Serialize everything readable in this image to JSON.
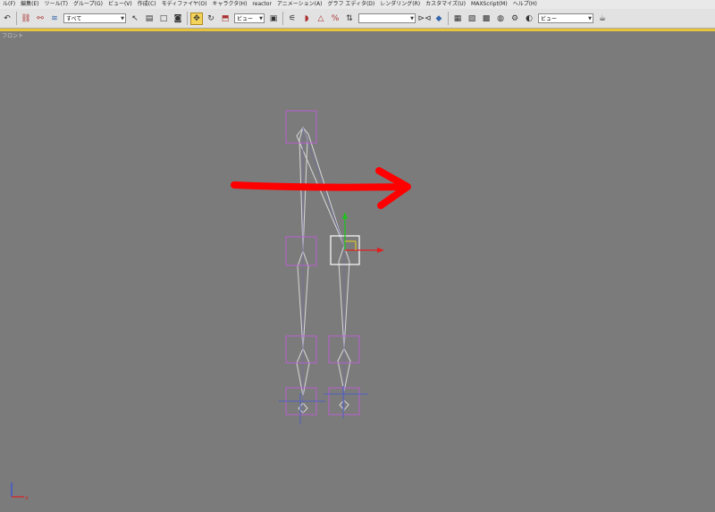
{
  "menu": [
    "ル(F)",
    "編集(E)",
    "ツール(T)",
    "グループ(G)",
    "ビュー(V)",
    "作成(C)",
    "モディファイヤ(O)",
    "キャラクタ(H)",
    "reactor",
    "アニメーション(A)",
    "グラフ エディタ(D)",
    "レンダリング(R)",
    "カスタマイズ(U)",
    "MAXScript(M)",
    "ヘルプ(H)"
  ],
  "toolbar": {
    "selection_filter": "すべて",
    "coord_system": "ビュー",
    "named_selection": "",
    "render_preset": "ビュー",
    "icons": [
      "undo-icon",
      "redo-icon",
      "link-icon",
      "unlink-icon",
      "bind-space-warp-icon",
      "select-icon",
      "select-by-name-icon",
      "rect-region-icon",
      "window-crossing-icon",
      "move-icon",
      "rotate-icon",
      "scale-icon",
      "pivot-icon",
      "manipulate-icon",
      "snap-icon",
      "angle-snap-icon",
      "percent-snap-icon",
      "spinner-snap-icon",
      "mirror-icon",
      "align-icon",
      "layer-icon",
      "curve-editor-icon",
      "schematic-icon",
      "material-editor-icon",
      "render-setup-icon",
      "quick-render-icon",
      "teapot-icon"
    ]
  },
  "viewport": {
    "label": "フロント",
    "axis_x": "x",
    "axis_y": "y"
  },
  "colors": {
    "viewport_bg": "#7b7b7b",
    "bone": "#d8d8d8",
    "bone_inner": "#6f6f9f",
    "selection_box": "#b85fd0",
    "arrow": "#ff0000",
    "gizmo_x": "#e02020",
    "gizmo_y": "#20c020",
    "active_tool": "#f3d35a"
  }
}
